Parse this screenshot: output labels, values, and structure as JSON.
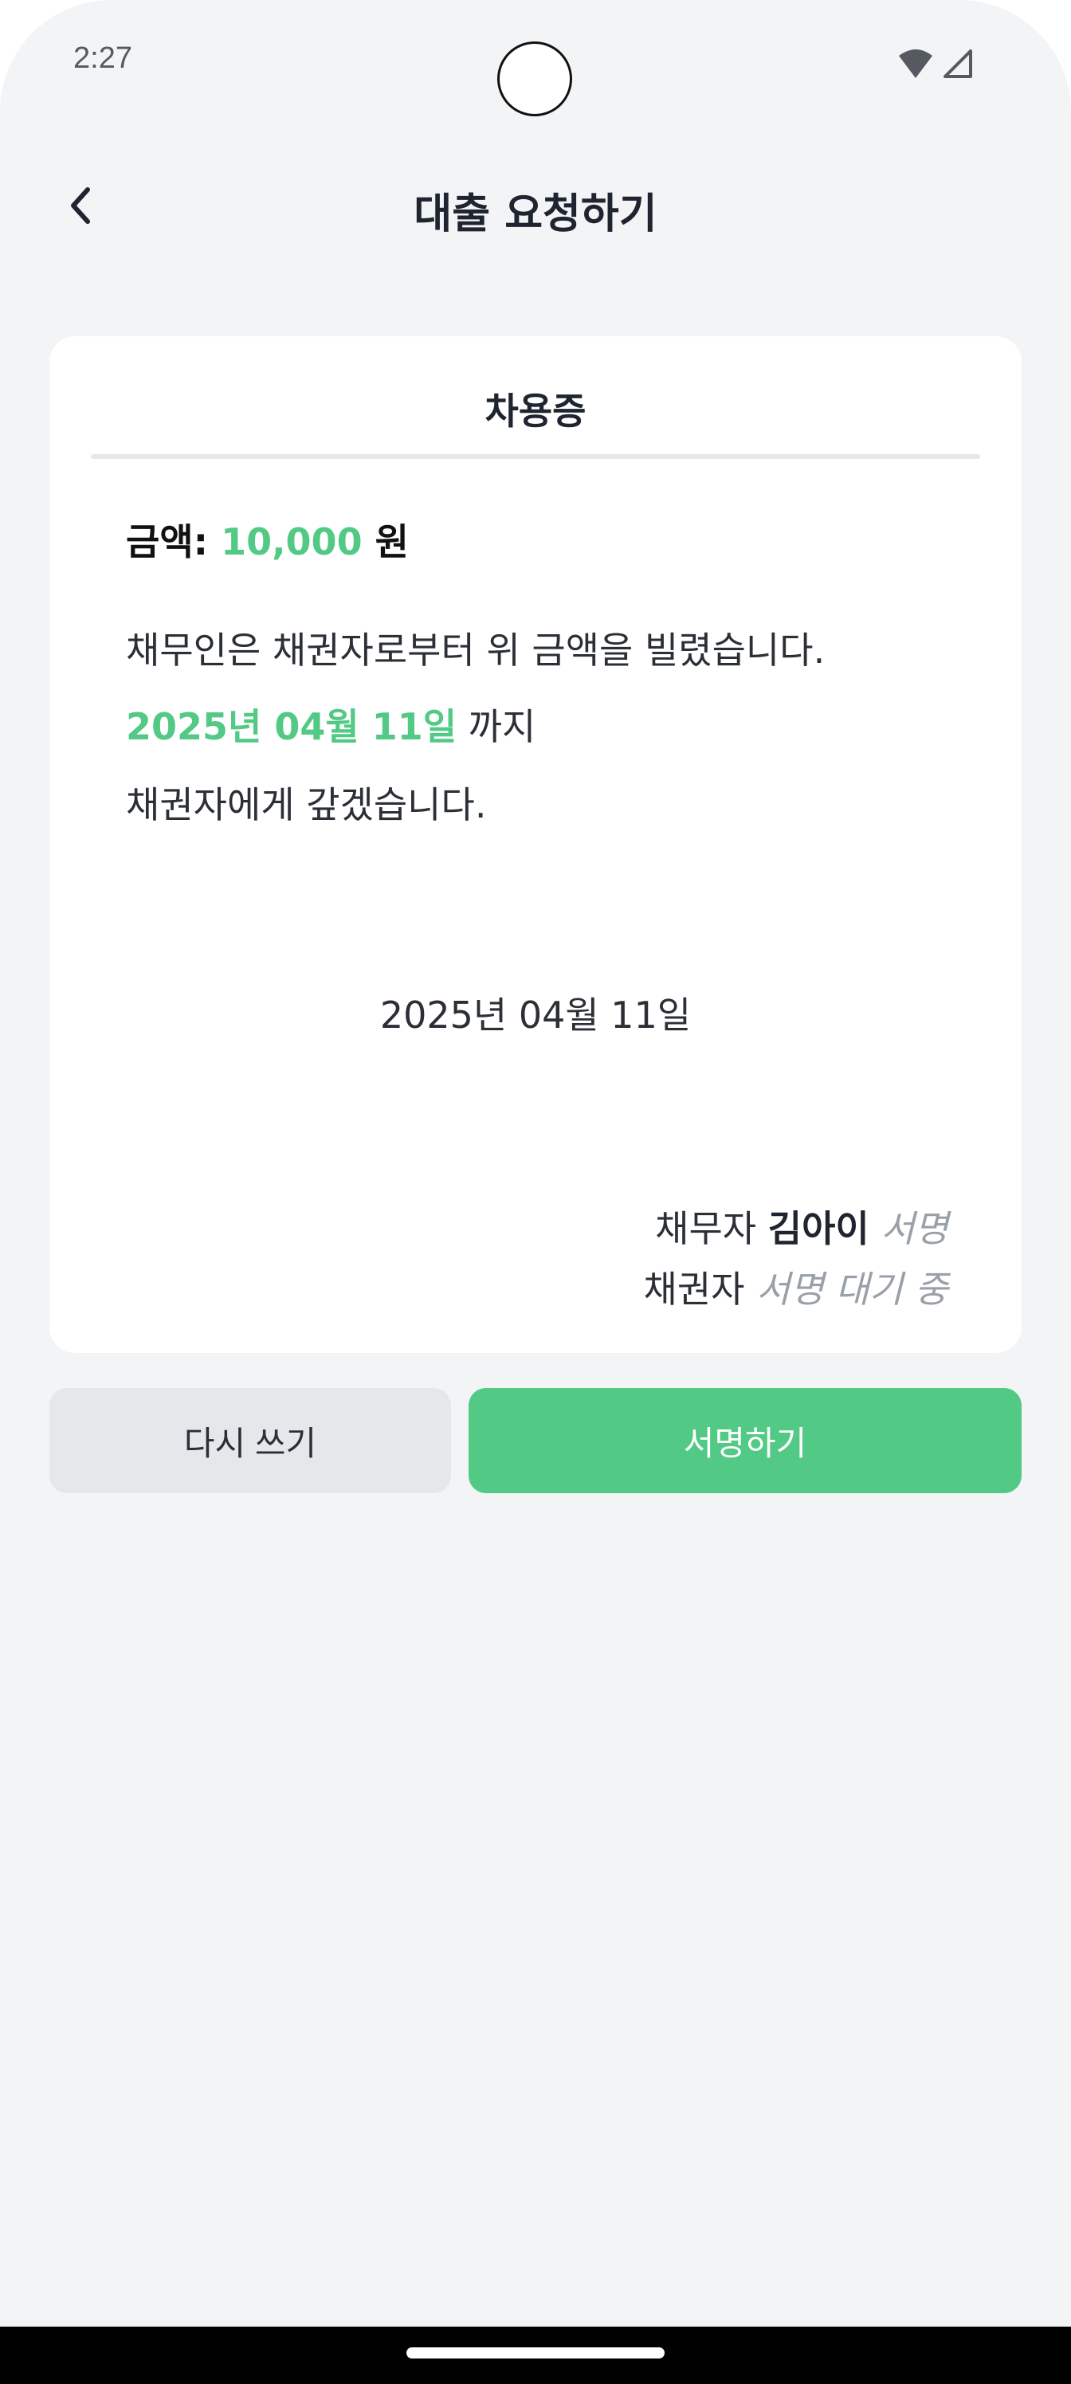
{
  "status_bar": {
    "time": "2:27",
    "icons": [
      "wifi-icon",
      "cellular-signal-icon"
    ]
  },
  "header": {
    "title": "대출 요청하기",
    "back_icon": "chevron-left-icon"
  },
  "card": {
    "title": "차용증",
    "amount_label": "금액:",
    "amount_value": "10,000",
    "amount_unit": "원",
    "line1": "채무인은 채권자로부터 위 금액을 빌렸습니다.",
    "due_date": "2025년 04월 11일",
    "due_suffix": "까지",
    "line3": "채권자에게 갚겠습니다.",
    "issue_date": "2025년 04월 11일",
    "debtor_label": "채무자",
    "debtor_name": "김아이",
    "debtor_sign_hint": "서명",
    "creditor_label": "채권자",
    "creditor_status": "서명 대기 중"
  },
  "actions": {
    "rewrite_label": "다시 쓰기",
    "sign_label": "서명하기"
  },
  "colors": {
    "accent": "#52c985",
    "background": "#f3f4f6",
    "card": "#ffffff",
    "secondary_button": "#e5e7eb"
  }
}
